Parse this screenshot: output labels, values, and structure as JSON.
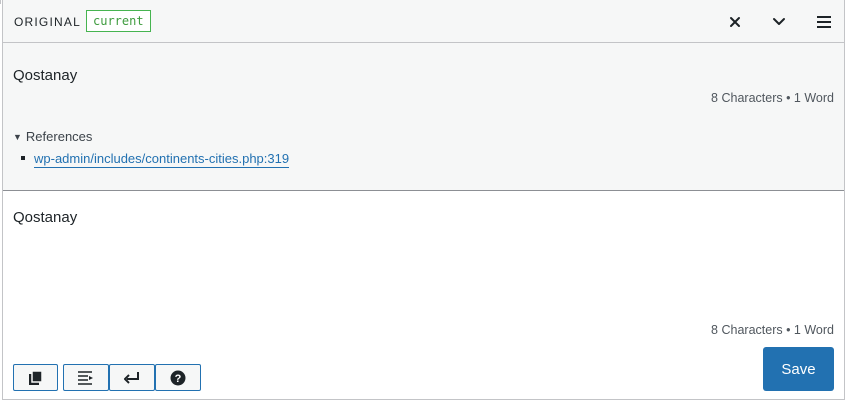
{
  "header": {
    "original_label": "ORIGINAL",
    "status_badge": "current",
    "icons": [
      "close-icon",
      "chevron-down-icon",
      "menu-icon"
    ]
  },
  "original": {
    "text": "Qostanay",
    "count": "8 Characters • 1 Word",
    "references_label": "References",
    "references": [
      "wp-admin/includes/continents-cities.php:319"
    ]
  },
  "translation": {
    "text": "Qostanay",
    "count": "8 Characters • 1 Word"
  },
  "toolbar": {
    "icons": [
      "copy-original-icon",
      "insert-tab-icon",
      "insert-newline-icon",
      "help-icon"
    ],
    "save_label": "Save"
  },
  "colors": {
    "accent": "#2271b1",
    "badge_green": "#46b450",
    "panel_bg": "#f6f7f7"
  }
}
